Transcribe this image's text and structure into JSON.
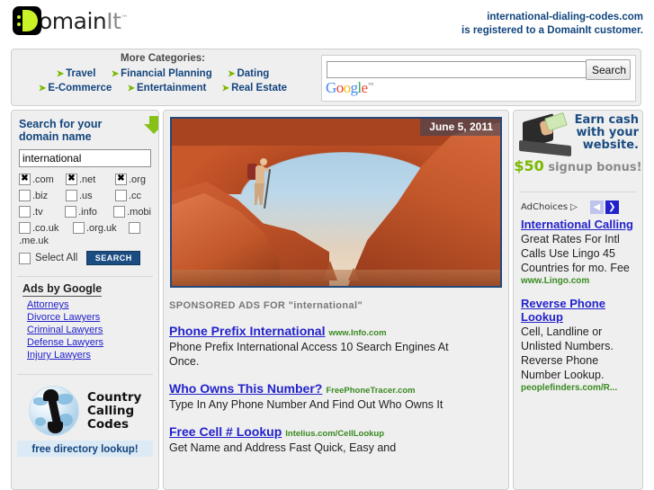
{
  "header": {
    "logo_text_black": "omain",
    "logo_text_gray": "It",
    "logo_tm": "™",
    "registered_line1": "international-dialing-codes.com",
    "registered_line2": "is registered to a DomainIt customer."
  },
  "topbar": {
    "more_categories_label": "More Categories:",
    "categories_row1": [
      "Travel",
      "Financial Planning",
      "Dating"
    ],
    "categories_row2": [
      "E-Commerce",
      "Entertainment",
      "Real Estate"
    ],
    "search_value": "",
    "search_placeholder": "",
    "search_button_label": "Search",
    "google_logo": {
      "g1": "G",
      "o1": "o",
      "o2": "o",
      "g2": "g",
      "l": "l",
      "e": "e",
      "tm": "™"
    }
  },
  "domain_search": {
    "heading": "Search for your domain name",
    "input_value": "international",
    "tlds": [
      {
        "label": ".com",
        "checked": true
      },
      {
        "label": ".net",
        "checked": true
      },
      {
        "label": ".org",
        "checked": true
      },
      {
        "label": ".biz",
        "checked": false
      },
      {
        "label": ".us",
        "checked": false
      },
      {
        "label": ".cc",
        "checked": false
      },
      {
        "label": ".tv",
        "checked": false
      },
      {
        "label": ".info",
        "checked": false
      },
      {
        "label": ".mobi",
        "checked": false
      },
      {
        "label": ".co.uk",
        "checked": false
      },
      {
        "label": ".org.uk",
        "checked": false
      },
      {
        "label": ".me.uk",
        "checked": false
      }
    ],
    "select_all_label": "Select All",
    "search_button_label": "SEARCH"
  },
  "ads_by_google": {
    "heading": "Ads by Google",
    "links": [
      "Attorneys",
      "Divorce Lawyers",
      "Criminal Lawyers",
      "Defense Lawyers",
      "Injury Lawyers"
    ]
  },
  "country_calling_codes": {
    "line1": "Country",
    "line2": "Calling",
    "line3": "Codes",
    "footer": "free directory lookup!"
  },
  "hero": {
    "date_badge": "June 5, 2011"
  },
  "sponsored": {
    "heading": "SPONSORED ADS FOR \"international\"",
    "ads": [
      {
        "title": "Phone Prefix International",
        "url": "www.Info.com",
        "description": "Phone Prefix International Access 10 Search Engines At Once."
      },
      {
        "title": "Who Owns This Number?",
        "url": "FreePhoneTracer.com",
        "description": "Type In Any Phone Number And Find Out Who Owns It"
      },
      {
        "title": "Free Cell # Lookup",
        "url": "Intelius.com/CellLookup",
        "description": "Get Name and Address Fast Quick, Easy and"
      }
    ]
  },
  "right_sidebar": {
    "earn_banner": {
      "line1": "Earn cash",
      "line2": "with your",
      "line3": "website.",
      "bonus_amount": "$50",
      "bonus_rest": "signup bonus!"
    },
    "adchoices_label": "AdChoices",
    "prev_label": "◀",
    "next_label": "❯",
    "ads": [
      {
        "title": "International Calling",
        "description": "Great Rates For Intl Calls Use Lingo 45 Countries for mo. Fee",
        "url": "www.Lingo.com"
      },
      {
        "title": "Reverse Phone Lookup",
        "description": "Cell, Landline or Unlisted Numbers. Reverse Phone Number Lookup.",
        "url": "peoplefinders.com/R..."
      }
    ]
  },
  "colors": {
    "brand_blue": "#13457e",
    "accent_green": "#7ab800",
    "link_blue": "#2222cc",
    "url_green": "#3a8a22",
    "panel_bg": "#efefef"
  }
}
